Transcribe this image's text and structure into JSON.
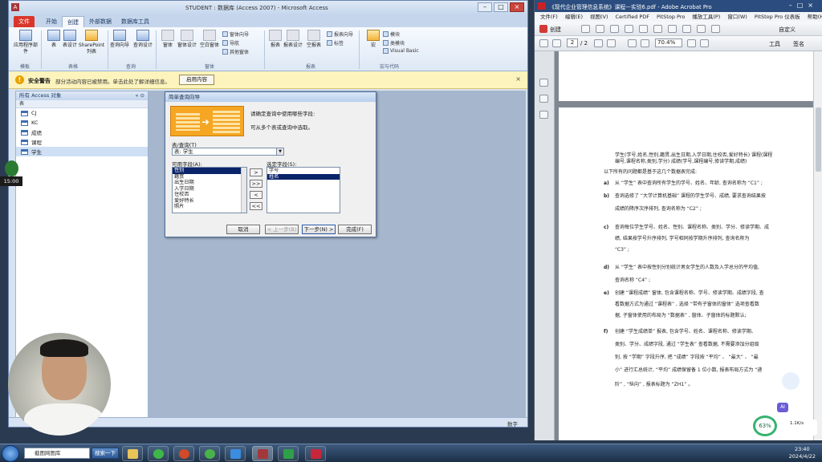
{
  "access": {
    "title": "STUDENT : 数据库 (Access 2007) - Microsoft Access",
    "tabs": [
      "文件",
      "开始",
      "创建",
      "外部数据",
      "数据库工具"
    ],
    "ribbon": {
      "buttons": [
        "应用程序部件",
        "表",
        "表设计",
        "SharePoint列表",
        "查询向导",
        "查询设计",
        "窗体",
        "窗体设计",
        "空白窗体",
        "报表",
        "报表设计",
        "空报表",
        "宏"
      ],
      "small_items": [
        "窗体向导",
        "导航",
        "其他窗体",
        "报表向导",
        "标签",
        "模块",
        "类模块",
        "Visual Basic"
      ],
      "groups": [
        "模板",
        "表格",
        "查询",
        "窗体",
        "报表",
        "宏与代码"
      ]
    },
    "warning": {
      "title": "安全警告",
      "message": "部分活动内容已被禁用。单击此处了解详细信息。",
      "button": "启用内容"
    },
    "nav": {
      "header": "所有 Access 对象",
      "section": "表",
      "items": [
        "CJ",
        "KC",
        "成绩",
        "课程",
        "学生"
      ]
    },
    "status_right": "数字"
  },
  "wizard": {
    "title": "简单查询向导",
    "prompt1": "请确定查询中使用哪些字段:",
    "prompt2": "可从多个表或查询中选取。",
    "table_label": "表/查询(T)",
    "table_value": "表: 学生",
    "available_label": "可用字段(A):",
    "available": [
      "性别",
      "籍贯",
      "出生日期",
      "入学日期",
      "住校否",
      "爱好特长",
      "照片"
    ],
    "selected_label": "选定字段(S):",
    "selected": [
      "学号",
      "姓名"
    ],
    "move_buttons": [
      ">",
      ">>",
      "<",
      "<<"
    ],
    "cancel": "取消",
    "back": "< 上一步(B)",
    "next": "下一步(N) >",
    "finish": "完成(F)"
  },
  "acrobat": {
    "title": "《现代企业管理信息系统》课程—实验6.pdf - Adobe Acrobat Pro",
    "menu": [
      "文件(F)",
      "编辑(E)",
      "视图(V)",
      "Certified PDF",
      "PitStop Pro",
      "播放工具(P)",
      "窗口(W)",
      "PitStop Pro 仪表板",
      "帮助(H)"
    ],
    "create": "创建",
    "customize": "自定义",
    "page_current": "2",
    "page_total": "/ 2",
    "zoom": "70.4%",
    "tools": "工具",
    "sign": "签名",
    "lines": [
      "学生(学号,姓名,性别,籍贯,出生日期,入学日期,住校否,爱好特长) 课程(课程",
      "编号,课程名称,类别,学分) 成绩(学号,课程编号,修读学期,成绩)",
      "以下所有的问题都是基于这几个数据表完成:",
      "从 “学生” 表中查询所有学生的学号、姓名、年龄, 查询名称为 “C1” ;",
      "查询选修了 “大学计算机基础” 课程的学生学号、成绩, 要求查询结果按",
      "成绩的降序次序排列, 查询名称为 “C2” ;",
      "查询每位学生学号、姓名、性别、课程名称、类别、学分、修读学期、成",
      "绩, 结果按学号升序排列, 学号相同按学期升序排列, 查询名称为",
      "“C3” ;",
      "从 “学生” 表中按性别分别统计男女学生的人数及入学总分的平均值,",
      "查询名称 “C4” ;",
      "创建 “课程成绩” 窗体, 包含课程名称、学号、修读学期、成绩字段, 查",
      "看数据方式为通过 “课程表” , 选择 “带有子窗体的窗体” 选项查看数",
      "据, 子窗体使用的布局为 “数据表” , 窗体、子窗体的标题默认;",
      "创建 “学生成绩单” 报表, 包含学号、姓名、课程名称、修读学期、",
      "类别、学分、成绩字段, 通过 “学生表” 查看数据, 不需要添加分组级",
      "别, 按 “学期” 字段升序, 把 “成绩” 字段按 “平均” 、 “最大” 、 “最",
      "小” 进行汇总统计, “平均” 成绩保留备 1 位小数, 报表布局方式为 “递",
      "阶” , “纵向” , 报表标题为 “ZH1” 。"
    ],
    "markers": [
      "a)",
      "b)",
      "c)",
      "d)",
      "e)",
      "f)"
    ]
  },
  "taskbar": {
    "address": "截图网图库",
    "search_btn": "搜索一下",
    "time": "23:40",
    "date": "2024/4/22"
  },
  "overlay": {
    "timer": "15:00",
    "cpu": "63%",
    "net": "1.1K/s"
  }
}
